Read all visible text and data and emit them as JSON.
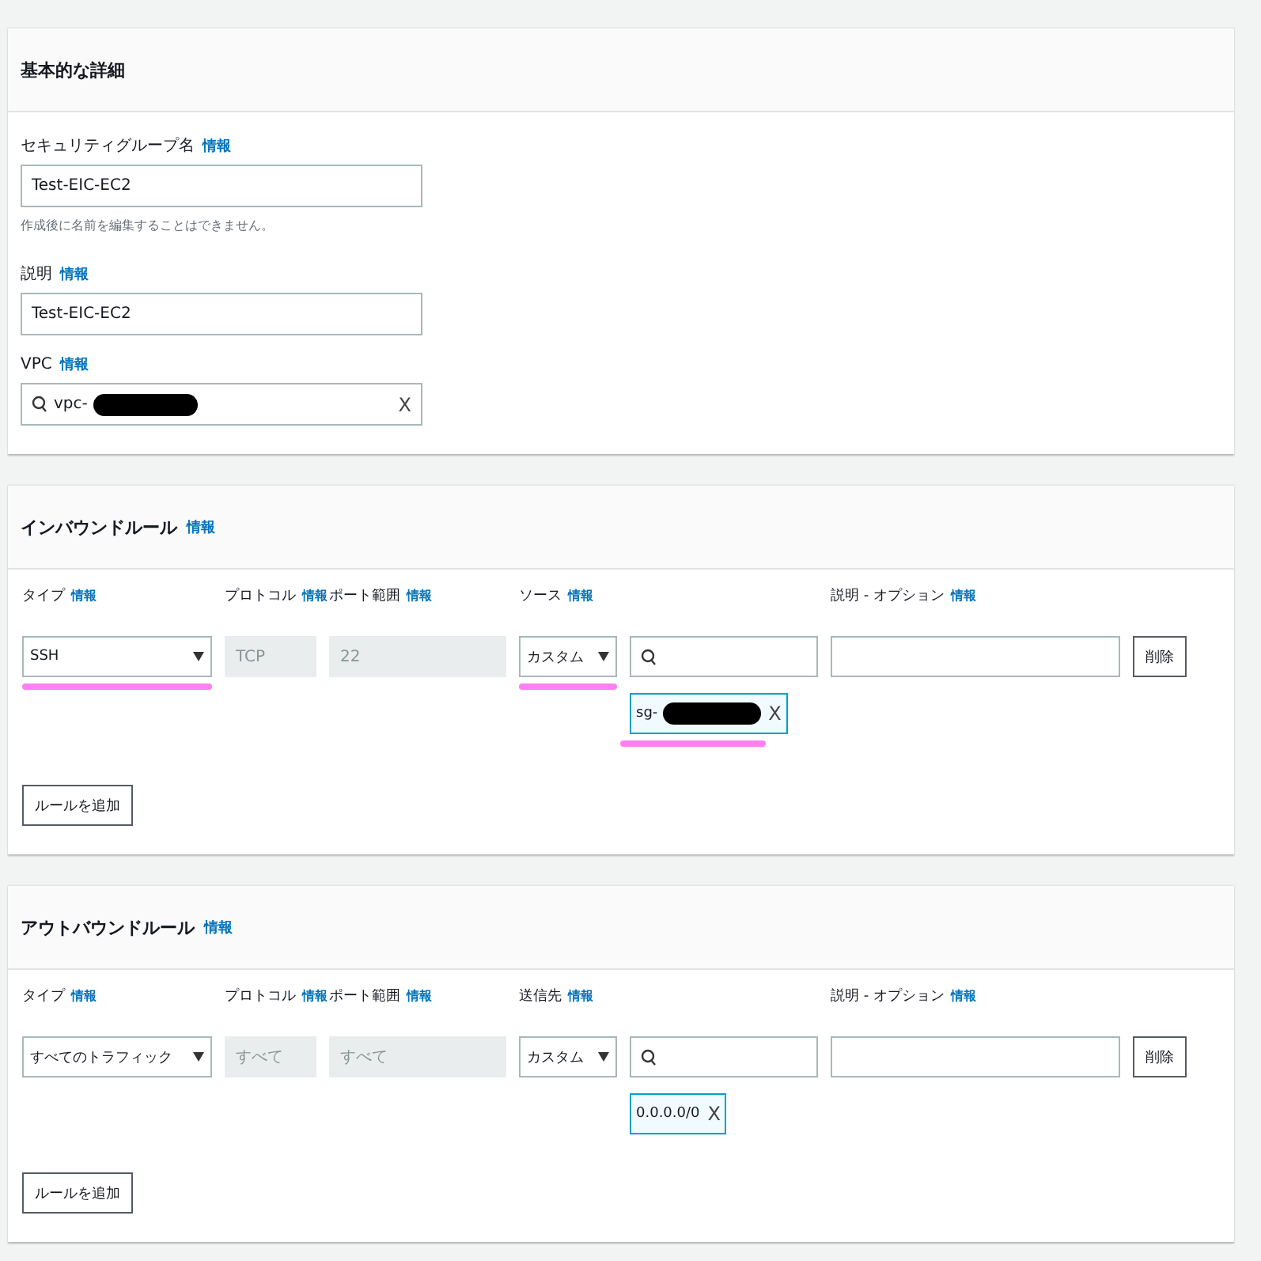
{
  "basic": {
    "title": "基本的な詳細",
    "fields": [
      {
        "kind": "text",
        "label": "セキュリティグループ名",
        "info": "情報",
        "value": "Test-EIC-EC2",
        "hint": "作成後に名前を編集することはできません。"
      },
      {
        "kind": "text",
        "label": "説明",
        "info": "情報",
        "value": "Test-EIC-EC2"
      },
      {
        "kind": "search",
        "label": "VPC",
        "info": "情報",
        "value": "vpc-",
        "redacted": true,
        "clear": "X"
      }
    ]
  },
  "rule_sections": [
    {
      "title": "インバウンドルール",
      "info": "情報",
      "columns": [
        {
          "label": "タイプ",
          "info": "情報"
        },
        {
          "label": "プロトコル",
          "info": "情報"
        },
        {
          "label": "ポート範囲",
          "info": "情報"
        },
        {
          "label": "ソース",
          "info": "情報"
        },
        {
          "label": "説明 - オプション",
          "info": "情報"
        }
      ],
      "rows": [
        {
          "type": "SSH",
          "type_highlighted": true,
          "protocol": "TCP",
          "port": "22",
          "source": "カスタム",
          "source_highlighted": true,
          "token": "sg-",
          "token_redacted": true,
          "token_highlighted": true,
          "clear": "X",
          "delete": "削除"
        }
      ],
      "add_button": "ルールを追加"
    },
    {
      "title": "アウトバウンドルール",
      "info": "情報",
      "columns": [
        {
          "label": "タイプ",
          "info": "情報"
        },
        {
          "label": "プロトコル",
          "info": "情報"
        },
        {
          "label": "ポート範囲",
          "info": "情報"
        },
        {
          "label": "送信先",
          "info": "情報"
        },
        {
          "label": "説明 - オプション",
          "info": "情報"
        }
      ],
      "rows": [
        {
          "type": "すべてのトラフィック",
          "type_highlighted": false,
          "protocol": "すべて",
          "port": "すべて",
          "source": "カスタム",
          "source_highlighted": false,
          "token": "0.0.0.0/0",
          "token_redacted": false,
          "token_highlighted": false,
          "clear": "X",
          "delete": "削除"
        }
      ],
      "add_button": "ルールを追加"
    }
  ]
}
